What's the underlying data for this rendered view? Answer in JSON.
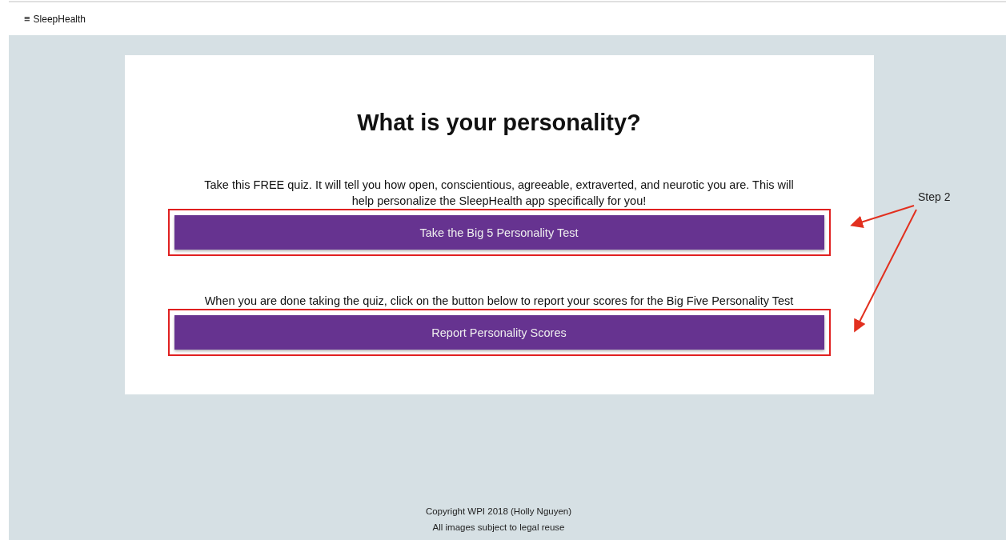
{
  "navbar": {
    "menu_icon": "≡",
    "brand": "SleepHealth"
  },
  "card": {
    "title": "What is your personality?",
    "sections": [
      {
        "text": "Take this FREE quiz. It will tell you how open, conscientious, agreeable, extraverted, and neurotic you are. This will help personalize the SleepHealth app specifically for you!",
        "button": "Take the Big 5 Personality Test",
        "highlighted": true
      },
      {
        "text": "When you are done taking the quiz, click on the button below to report your scores for the Big Five Personality Test",
        "button": "Report Personality Scores",
        "highlighted": true
      }
    ]
  },
  "annotation": {
    "label": "Step 2"
  },
  "footer": [
    "Copyright WPI 2018 (Holly Nguyen)",
    "All images subject to legal reuse"
  ]
}
